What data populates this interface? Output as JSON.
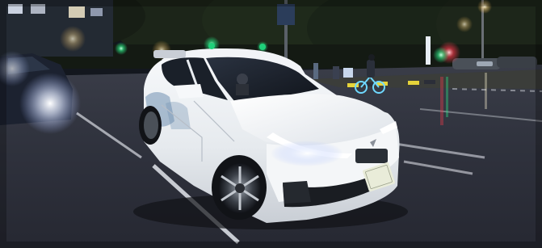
{
  "scene": {
    "description_tags": [
      "night",
      "city-street",
      "robotaxi",
      "wide-angle"
    ],
    "vehicle": {
      "color": "#eef1f4",
      "livery_accent": "#6f8fb0",
      "roof_lidar_color": "#1fd07a",
      "plate": {
        "text": "",
        "color": "#e9ecd9"
      }
    },
    "colors": {
      "sky": "#0d1117",
      "road": "#2b2e38",
      "lane_marking": "#d8dbe2",
      "trees": "#1a2418",
      "streetlight_glow": "#fff6d6",
      "headlight_glow": "#f5f7ff",
      "neon_red": "#ff3b4d",
      "neon_green": "#2cf08a"
    }
  }
}
